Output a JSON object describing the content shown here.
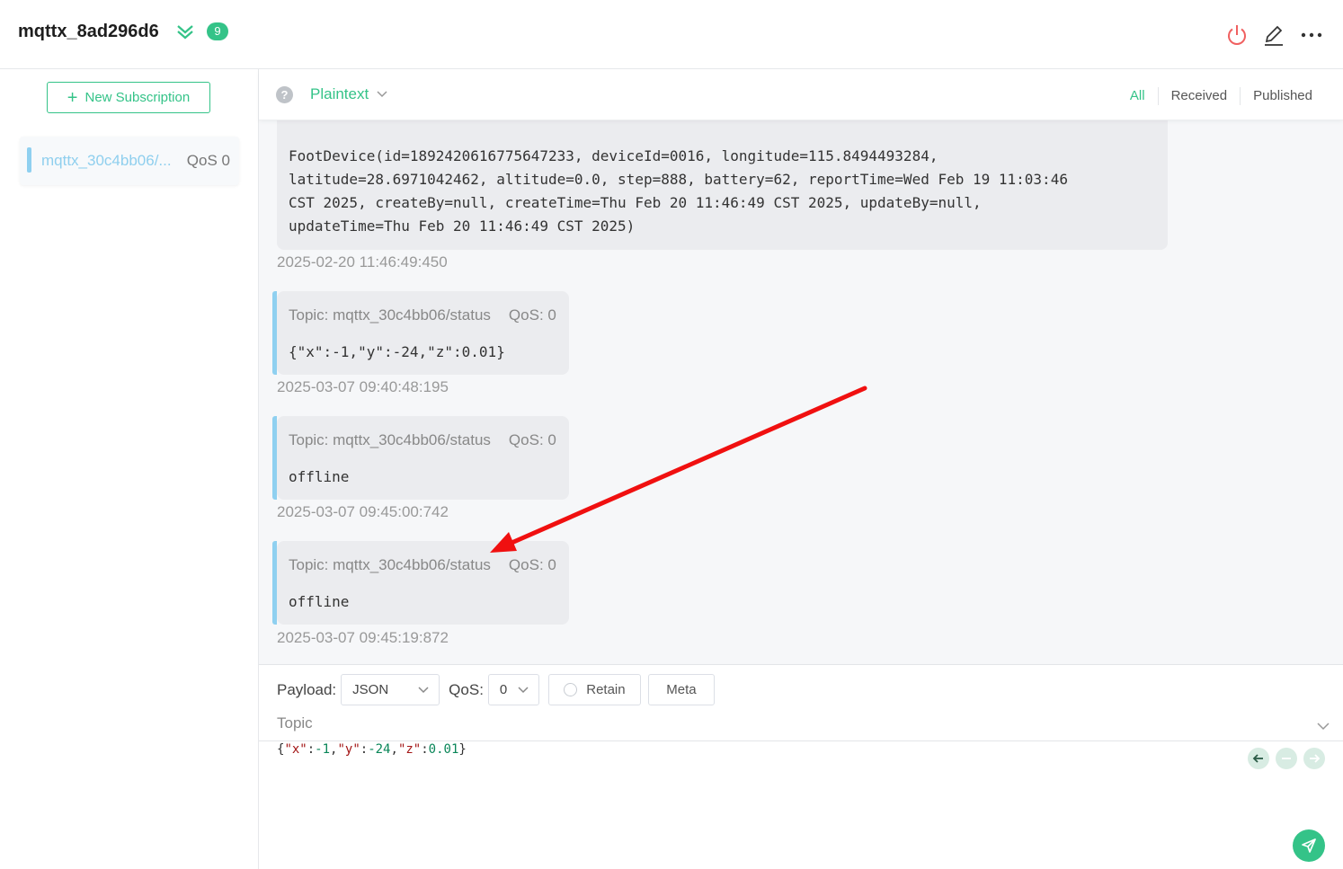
{
  "header": {
    "connection_name": "mqttx_8ad296d6",
    "badge_count": "9"
  },
  "sidebar": {
    "new_subscription_label": "New Subscription",
    "subscriptions": [
      {
        "topic": "mqttx_30c4bb06/...",
        "qos": "QoS 0",
        "color": "#8fd0f0"
      }
    ]
  },
  "toolbar": {
    "format": "Plaintext",
    "tabs": [
      "All",
      "Received",
      "Published"
    ],
    "active_tab": "All"
  },
  "messages": [
    {
      "payload": "FootDevice(id=1892420616775647233, deviceId=0016, longitude=115.8494493284,\nlatitude=28.6971042462, altitude=0.0, step=888, battery=62, reportTime=Wed Feb 19 11:03:46\nCST 2025, createBy=null, createTime=Thu Feb 20 11:46:49 CST 2025, updateBy=null,\nupdateTime=Thu Feb 20 11:46:49 CST 2025)",
      "time": "2025-02-20 11:46:49:450"
    },
    {
      "topic": "Topic: mqttx_30c4bb06/status",
      "qos": "QoS: 0",
      "payload": "{\"x\":-1,\"y\":-24,\"z\":0.01}",
      "time": "2025-03-07 09:40:48:195"
    },
    {
      "topic": "Topic: mqttx_30c4bb06/status",
      "qos": "QoS: 0",
      "payload": "offline",
      "time": "2025-03-07 09:45:00:742"
    },
    {
      "topic": "Topic: mqttx_30c4bb06/status",
      "qos": "QoS: 0",
      "payload": "offline",
      "time": "2025-03-07 09:45:19:872"
    }
  ],
  "composer": {
    "payload_label": "Payload:",
    "payload_type": "JSON",
    "qos_label": "QoS:",
    "qos_value": "0",
    "retain_label": "Retain",
    "meta_label": "Meta",
    "topic_placeholder": "Topic",
    "payload_tokens": {
      "open": "{",
      "k1": "\"x\"",
      "c1": ":",
      "v1": "-1",
      "sep1": ",",
      "k2": "\"y\"",
      "c2": ":",
      "v2": "-24",
      "sep2": ",",
      "k3": "\"z\"",
      "c3": ":",
      "v3": "0.01",
      "close": "}"
    }
  },
  "colors": {
    "accent": "#34c388",
    "annotation_arrow": "#f01010"
  }
}
